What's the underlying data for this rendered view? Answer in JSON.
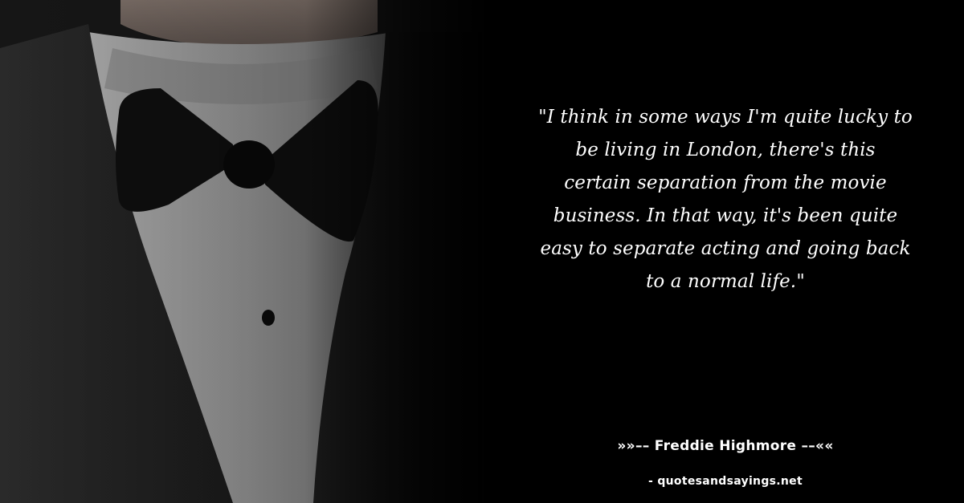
{
  "image": {
    "subject": "tuxedo-with-bow-tie-photo"
  },
  "quote": {
    "lines": [
      "\"I think in some ways I'm quite lucky to",
      "be living in London, there's this",
      "certain separation from the movie",
      "business. In that way, it's been quite",
      "easy to separate acting and going back",
      "to a normal life.\""
    ]
  },
  "attribution": {
    "author": "»»–– Freddie Highmore ––««",
    "source": "- quotesandsayings.net"
  },
  "colors": {
    "background": "#000000",
    "text": "#ffffff"
  }
}
